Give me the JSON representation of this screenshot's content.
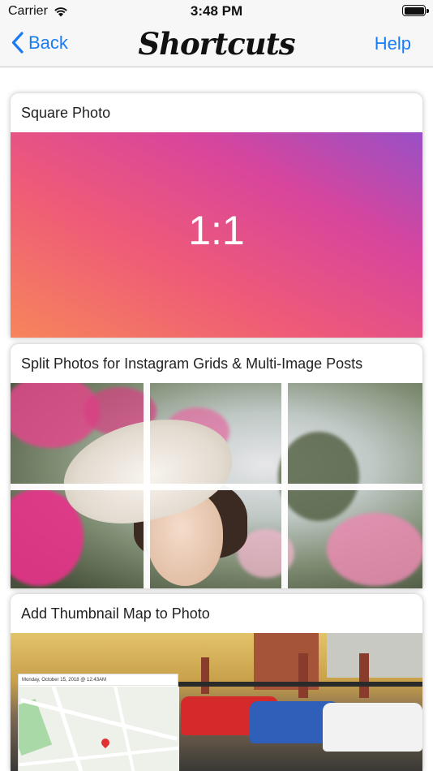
{
  "status_bar": {
    "carrier": "Carrier",
    "time": "3:48 PM",
    "wifi_icon": "wifi-icon",
    "battery_icon": "battery-icon"
  },
  "nav": {
    "back_label": "Back",
    "back_icon": "chevron-left-icon",
    "title": "Shortcuts",
    "help_label": "Help",
    "accent_color": "#1a7cf5"
  },
  "cards": [
    {
      "title": "Square Photo",
      "image_text": "1:1"
    },
    {
      "title": "Split Photos for Instagram Grids & Multi-Image Posts"
    },
    {
      "title": "Add Thumbnail Map to Photo",
      "map_date": "Monday, October 15, 2018 @ 12:43AM"
    }
  ]
}
